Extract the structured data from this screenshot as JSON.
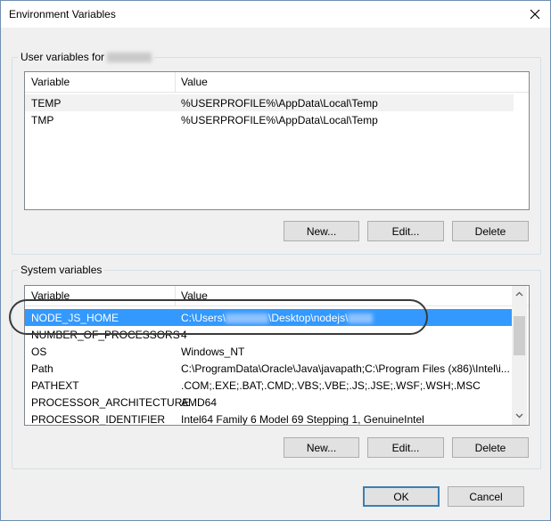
{
  "window": {
    "title": "Environment Variables"
  },
  "user_vars": {
    "group_label": "User variables for",
    "columns": [
      "Variable",
      "Value"
    ],
    "rows": [
      {
        "name": "TEMP",
        "value": "%USERPROFILE%\\AppData\\Local\\Temp"
      },
      {
        "name": "TMP",
        "value": "%USERPROFILE%\\AppData\\Local\\Temp"
      }
    ],
    "buttons": {
      "new": "New...",
      "edit": "Edit...",
      "delete": "Delete"
    }
  },
  "system_vars": {
    "group_label": "System variables",
    "columns": [
      "Variable",
      "Value"
    ],
    "rows": [
      {
        "name": "NODE_JS_HOME",
        "value_prefix": "C:\\Users\\",
        "value_suffix": "\\Desktop\\nodejs\\"
      },
      {
        "name": "NUMBER_OF_PROCESSORS",
        "value": "4"
      },
      {
        "name": "OS",
        "value": "Windows_NT"
      },
      {
        "name": "Path",
        "value": "C:\\ProgramData\\Oracle\\Java\\javapath;C:\\Program Files (x86)\\Intel\\i..."
      },
      {
        "name": "PATHEXT",
        "value": ".COM;.EXE;.BAT;.CMD;.VBS;.VBE;.JS;.JSE;.WSF;.WSH;.MSC"
      },
      {
        "name": "PROCESSOR_ARCHITECTURE",
        "value": "AMD64"
      },
      {
        "name": "PROCESSOR_IDENTIFIER",
        "value": "Intel64 Family 6 Model 69 Stepping 1, GenuineIntel"
      }
    ],
    "buttons": {
      "new": "New...",
      "edit": "Edit...",
      "delete": "Delete"
    }
  },
  "footer": {
    "ok": "OK",
    "cancel": "Cancel"
  },
  "colors": {
    "selection": "#3399ff",
    "annotation": "#3a3a3a"
  }
}
